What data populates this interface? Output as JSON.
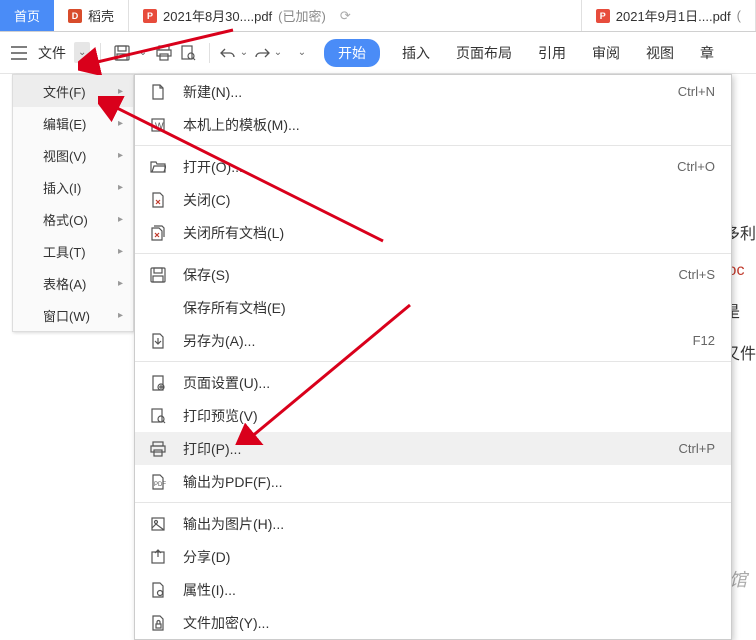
{
  "tabs": {
    "home": "首页",
    "docell": "稻壳",
    "pdf1": {
      "name": "2021年8月30....pdf",
      "suffix": "(已加密)"
    },
    "pdf2": {
      "name": "2021年9月1日....pdf",
      "suffix": "("
    }
  },
  "toolbar": {
    "file": "文件"
  },
  "ribbon": {
    "start": "开始",
    "insert": "插入",
    "page_layout": "页面布局",
    "references": "引用",
    "review": "审阅",
    "view": "视图",
    "section": "章"
  },
  "side_menu": {
    "file": "文件(F)",
    "edit": "编辑(E)",
    "view": "视图(V)",
    "insert": "插入(I)",
    "format": "格式(O)",
    "tools": "工具(T)",
    "table": "表格(A)",
    "window": "窗口(W)"
  },
  "file_menu": {
    "new": {
      "label": "新建(N)...",
      "shortcut": "Ctrl+N"
    },
    "local_template": {
      "label": "本机上的模板(M)..."
    },
    "open": {
      "label": "打开(O)...",
      "shortcut": "Ctrl+O"
    },
    "close": {
      "label": "关闭(C)"
    },
    "close_all": {
      "label": "关闭所有文档(L)"
    },
    "save": {
      "label": "保存(S)",
      "shortcut": "Ctrl+S"
    },
    "save_all": {
      "label": "保存所有文档(E)"
    },
    "save_as": {
      "label": "另存为(A)...",
      "shortcut": "F12"
    },
    "page_setup": {
      "label": "页面设置(U)..."
    },
    "print_preview": {
      "label": "打印预览(V)"
    },
    "print": {
      "label": "打印(P)...",
      "shortcut": "Ctrl+P"
    },
    "export_pdf": {
      "label": "输出为PDF(F)..."
    },
    "export_image": {
      "label": "输出为图片(H)..."
    },
    "share": {
      "label": "分享(D)"
    },
    "properties": {
      "label": "属性(I)..."
    },
    "encrypt": {
      "label": "文件加密(Y)..."
    }
  },
  "right_edge": {
    "t1": "多利",
    "t2": "loc",
    "t3": "是",
    "t4": "又件"
  },
  "watermark": "易坊好文馆"
}
